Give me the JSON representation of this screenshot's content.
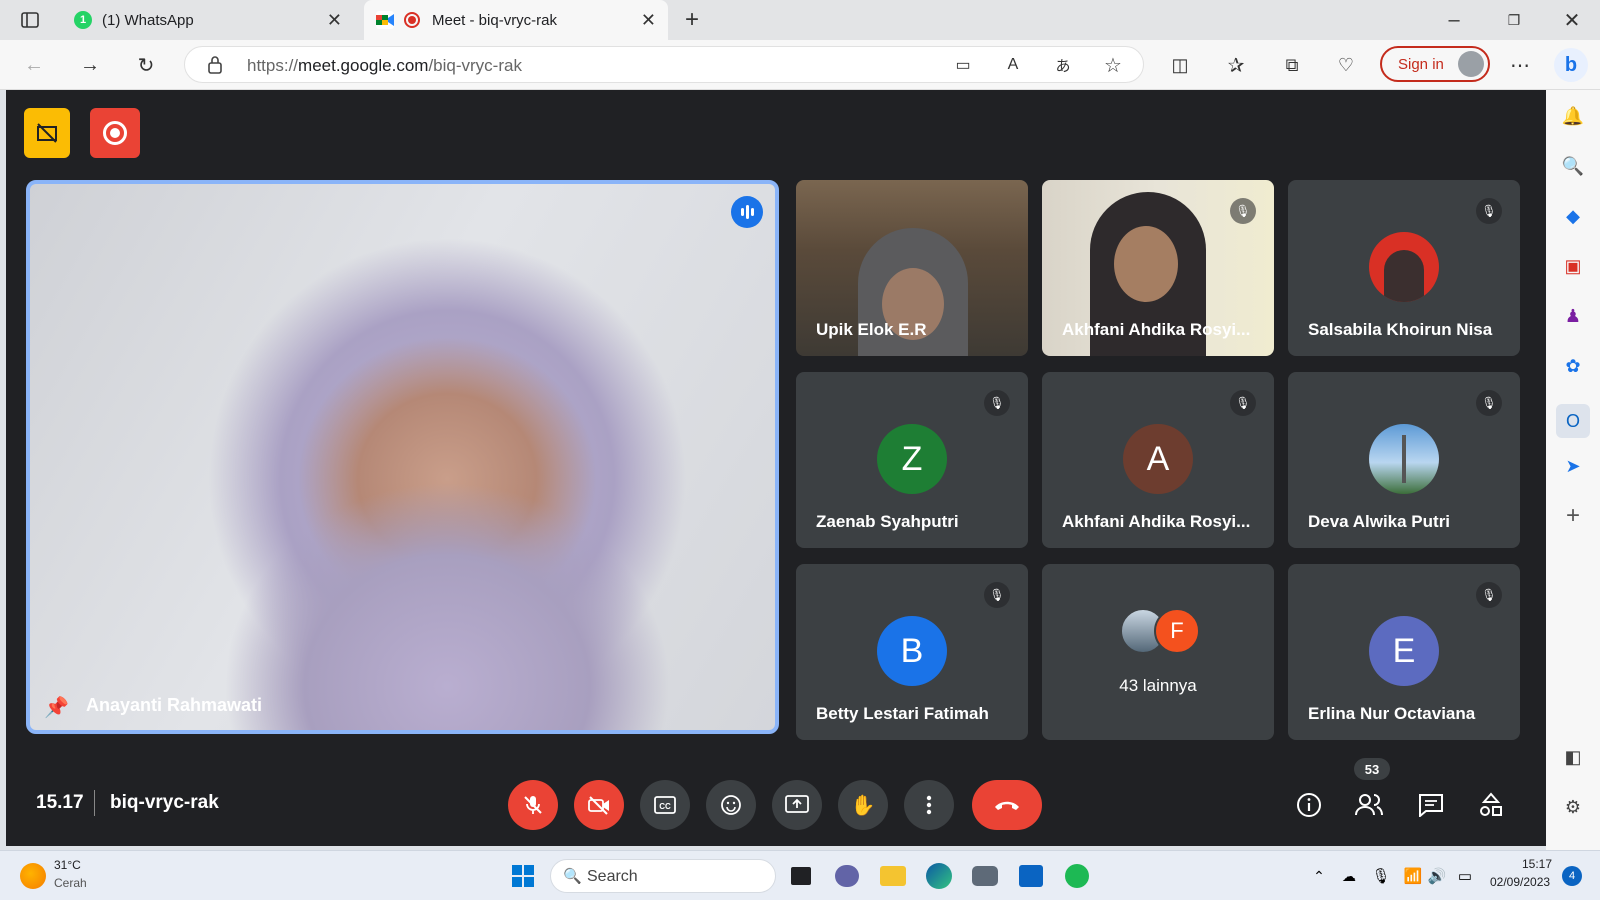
{
  "browser": {
    "tabs": [
      {
        "title": "(1) WhatsApp",
        "badge": "1"
      },
      {
        "title": "Meet - biq-vryc-rak"
      }
    ],
    "url": {
      "prefix": "https://",
      "domain": "meet.google.com",
      "path": "/biq-vryc-rak"
    },
    "signin_label": "Sign in"
  },
  "meet": {
    "main_participant": "Anayanti Rahmawati",
    "participants": [
      {
        "name": "Upik Elok E.R",
        "type": "video"
      },
      {
        "name": "Akhfani Ahdika Rosyi...",
        "type": "video"
      },
      {
        "name": "Salsabila Khoirun Nisa",
        "type": "photo"
      },
      {
        "name": "Zaenab Syahputri",
        "initial": "Z",
        "color": "#1e7e34"
      },
      {
        "name": "Akhfani Ahdika Rosyi...",
        "initial": "A",
        "color": "#6d3d2f"
      },
      {
        "name": "Deva Alwika Putri",
        "type": "photo"
      },
      {
        "name": "Betty Lestari Fatimah",
        "initial": "B",
        "color": "#1a73e8"
      },
      {
        "name": "43 lainnya",
        "initial": "F",
        "color": "#f4511e"
      },
      {
        "name": "Erlina Nur Octaviana",
        "initial": "E",
        "color": "#5c6bc0"
      }
    ],
    "time": "15.17",
    "meeting_code": "biq-vryc-rak",
    "people_count": "53"
  },
  "taskbar": {
    "weather_temp": "31°C",
    "weather_desc": "Cerah",
    "search_placeholder": "Search",
    "clock_time": "15:17",
    "clock_date": "02/09/2023",
    "notification_count": "4"
  }
}
